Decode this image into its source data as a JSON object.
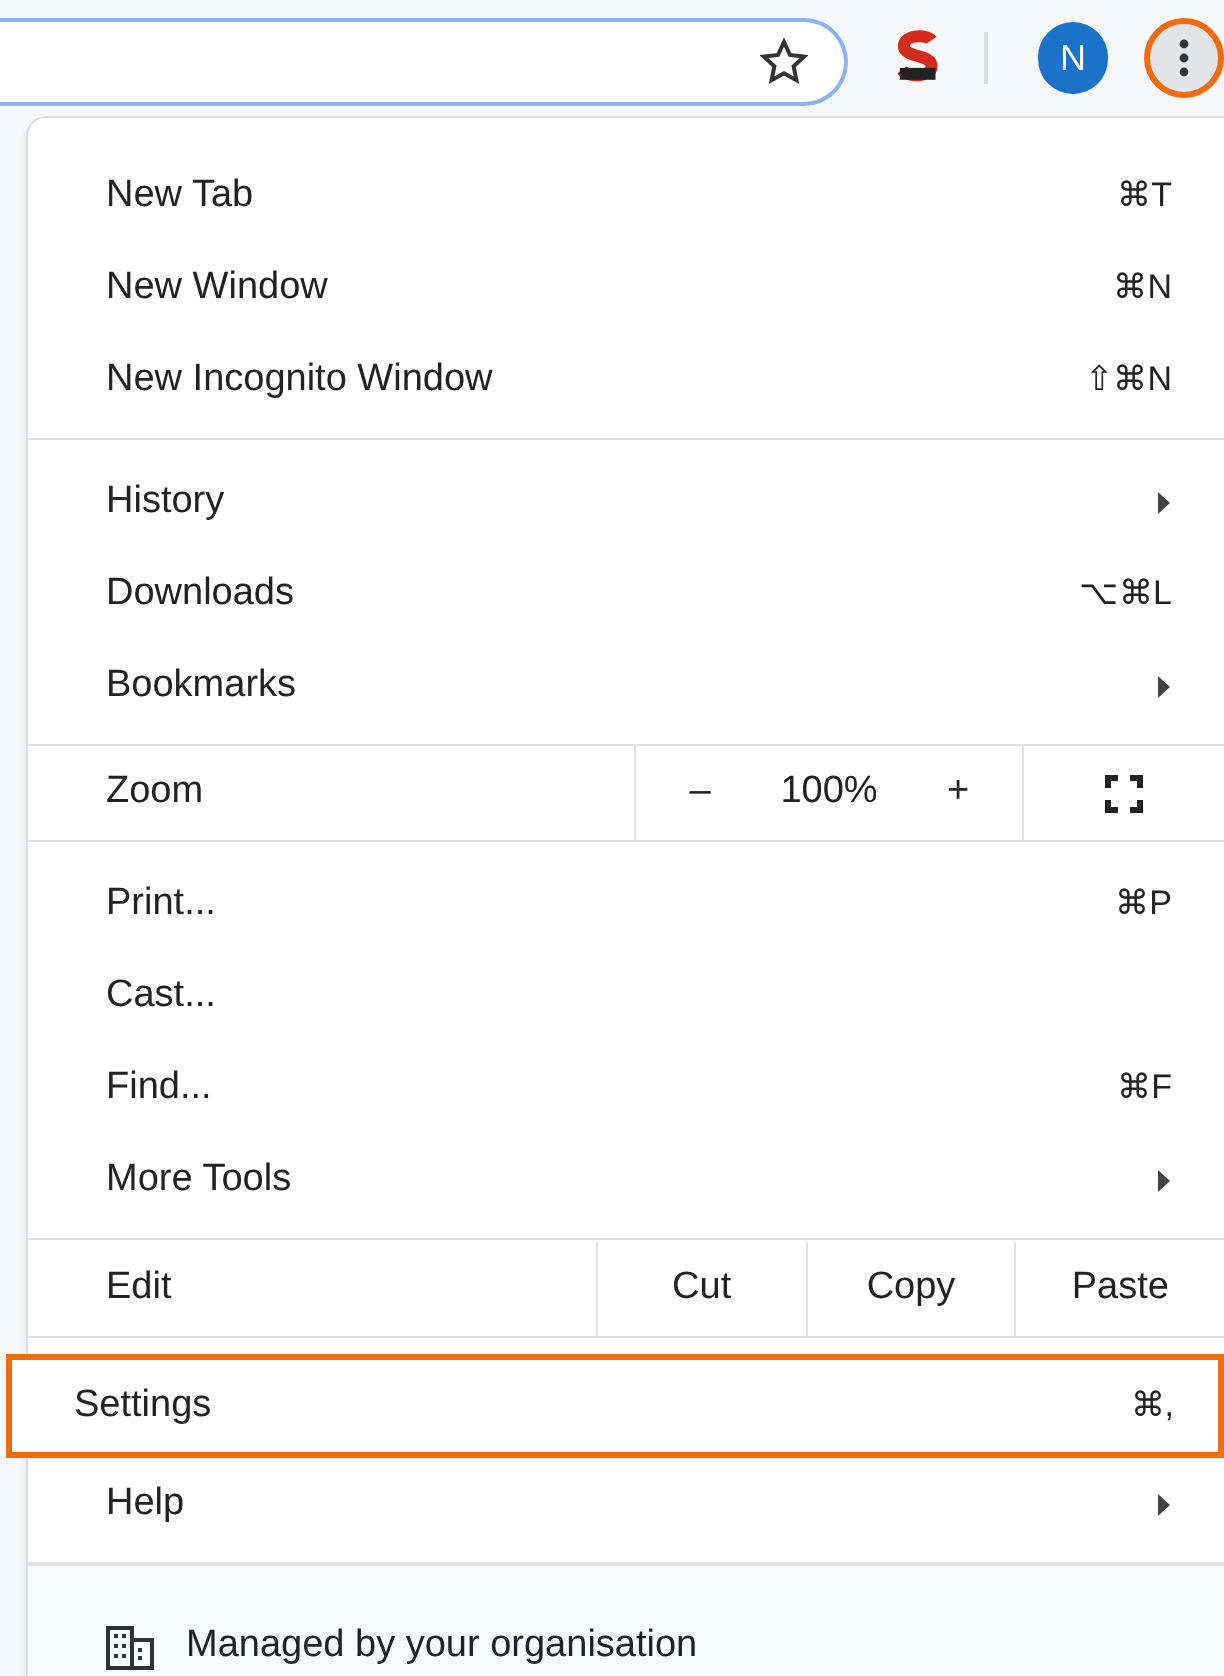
{
  "toolbar": {
    "avatar": "N",
    "menu_button_highlighted": true
  },
  "menu": {
    "sections": [
      {
        "kind": "items",
        "items": [
          {
            "label": "New Tab",
            "shortcut": "⌘T",
            "submenu": false,
            "highlighted": false
          },
          {
            "label": "New Window",
            "shortcut": "⌘N",
            "submenu": false,
            "highlighted": false
          },
          {
            "label": "New Incognito Window",
            "shortcut": "⇧⌘N",
            "submenu": false,
            "highlighted": false
          }
        ]
      },
      {
        "kind": "items",
        "items": [
          {
            "label": "History",
            "submenu": true,
            "highlighted": false
          },
          {
            "label": "Downloads",
            "shortcut": "⌥⌘L",
            "submenu": false,
            "highlighted": false
          },
          {
            "label": "Bookmarks",
            "submenu": true,
            "highlighted": false
          }
        ]
      },
      {
        "kind": "zoom",
        "label": "Zoom",
        "minus": "–",
        "value": "100%",
        "plus": "+"
      },
      {
        "kind": "items",
        "items": [
          {
            "label": "Print...",
            "shortcut": "⌘P",
            "submenu": false,
            "highlighted": false
          },
          {
            "label": "Cast...",
            "submenu": false,
            "highlighted": false
          },
          {
            "label": "Find...",
            "shortcut": "⌘F",
            "submenu": false,
            "highlighted": false
          },
          {
            "label": "More Tools",
            "submenu": true,
            "highlighted": false
          }
        ]
      },
      {
        "kind": "edit",
        "label": "Edit",
        "buttons": [
          "Cut",
          "Copy",
          "Paste"
        ]
      },
      {
        "kind": "items",
        "items": [
          {
            "label": "Settings",
            "shortcut": "⌘,",
            "submenu": false,
            "highlighted": true
          },
          {
            "label": "Help",
            "submenu": true,
            "highlighted": false
          }
        ]
      },
      {
        "kind": "footer",
        "label": "Managed by your organisation"
      }
    ]
  }
}
